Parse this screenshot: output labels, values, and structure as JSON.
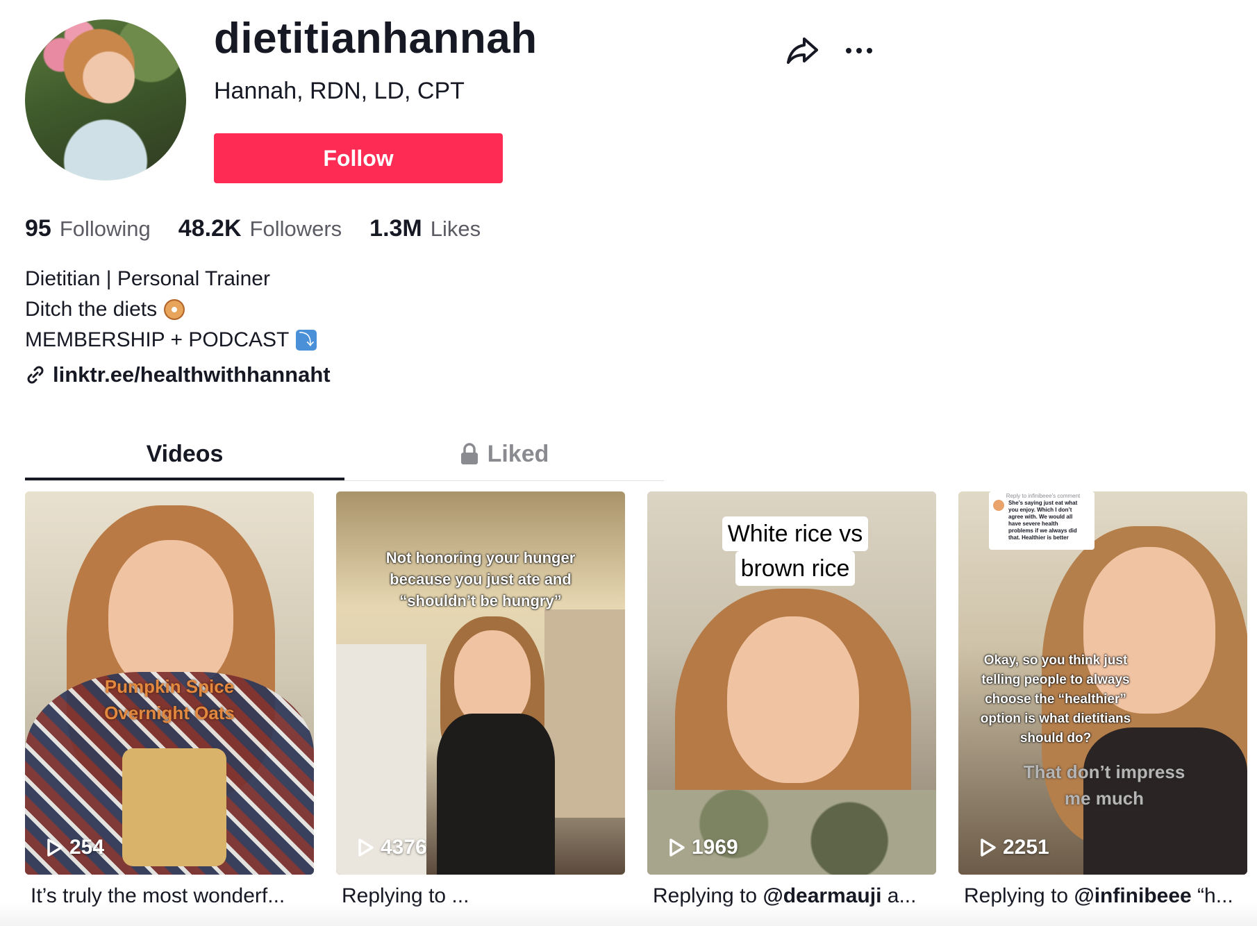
{
  "profile": {
    "username": "dietitianhannah",
    "subtitle": "Hannah, RDN, LD, CPT",
    "follow_label": "Follow"
  },
  "stats": [
    {
      "value": "95",
      "label": "Following"
    },
    {
      "value": "48.2K",
      "label": "Followers"
    },
    {
      "value": "1.3M",
      "label": "Likes"
    }
  ],
  "bio": {
    "line1": "Dietitian | Personal Trainer",
    "line2": "Ditch the diets",
    "line3": "MEMBERSHIP + PODCAST",
    "link": "linktr.ee/healthwithhannaht"
  },
  "tabs": [
    {
      "label": "Videos",
      "active": true
    },
    {
      "label": "Liked",
      "active": false
    }
  ],
  "videos": [
    {
      "plays": "254",
      "overlay": [
        "Pumpkin Spice",
        "Overnight Oats"
      ],
      "caption": "It’s truly the most wonderf..."
    },
    {
      "plays": "4376",
      "overlay": [
        "Not honoring your hunger",
        "because you just ate and",
        "“shouldn’t be hungry”"
      ],
      "caption": "Replying to ..."
    },
    {
      "plays": "1969",
      "overlay": [
        "White rice vs",
        "brown rice"
      ],
      "caption_prefix": "Replying to ",
      "caption_handle": "@dearmauji",
      "caption_suffix": " a..."
    },
    {
      "plays": "2251",
      "comment_title": "Reply to infinibeee’s comment",
      "comment_lines": [
        "She’s saying just eat what",
        "you enjoy. Which I don’t",
        "agree with. We would all",
        "have severe health",
        "problems if we always did",
        "that. Healthier is better"
      ],
      "overlay": [
        "Okay, so you think just",
        "telling people to always",
        "choose the “healthier”",
        "option is what dietitians",
        "should do?"
      ],
      "overlay2": [
        "That don’t impress",
        "me much"
      ],
      "caption_prefix": "Replying to ",
      "caption_handle": "@infinibeee",
      "caption_suffix": " “h..."
    }
  ],
  "colors": {
    "follow": "#fe2c55",
    "text": "#161823",
    "muted": "#5b5c63",
    "tab_inactive": "#8a8b91"
  },
  "icons": [
    "share-icon",
    "more-icon",
    "link-icon",
    "lock-icon",
    "play-icon"
  ]
}
